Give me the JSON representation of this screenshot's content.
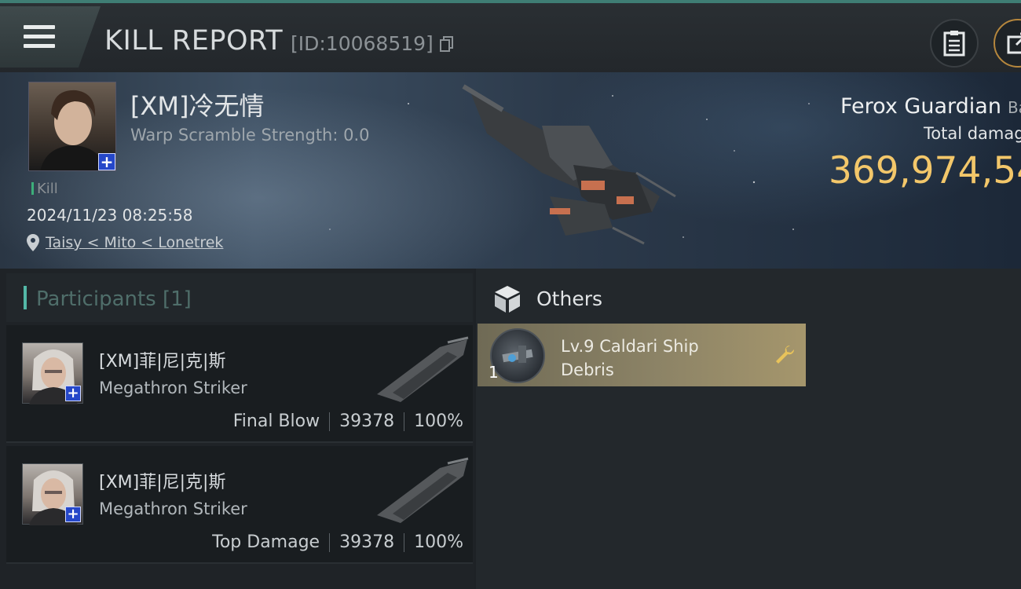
{
  "header": {
    "title": "KILL REPORT",
    "report_id": "[ID:10068519]"
  },
  "victim": {
    "name": "[XM]冷无情",
    "warp_scramble": "Warp Scramble Strength: 0.0",
    "kill_label": "Kill",
    "datetime": "2024/11/23 08:25:58",
    "location": "Taisy < Mito < Lonetrek",
    "ship_name": "Ferox Guardian",
    "ship_class_partial": "Ba",
    "total_damage_label": "Total damag",
    "total_damage_value": "369,974,54"
  },
  "participants": {
    "title": "Participants [1]",
    "rows": [
      {
        "name": "[XM]菲|尼|克|斯",
        "ship": "Megathron Striker",
        "role": "Final Blow",
        "damage": "39378",
        "percent": "100%"
      },
      {
        "name": "[XM]菲|尼|克|斯",
        "ship": "Megathron Striker",
        "role": "Top Damage",
        "damage": "39378",
        "percent": "100%"
      }
    ]
  },
  "others": {
    "title": "Others",
    "items": [
      {
        "quantity": "1",
        "name": "Lv.9 Caldari Ship Debris"
      }
    ]
  },
  "colors": {
    "accent_teal": "#53b8a7",
    "damage_gold": "#f3c76a",
    "item_card_gold": "#a5966c",
    "badge_blue": "#2547c9"
  },
  "icons": [
    "menu-icon",
    "copy-icon",
    "report-icon",
    "share-icon",
    "location-pin-icon",
    "cube-icon",
    "wrench-icon",
    "plus-icon"
  ]
}
